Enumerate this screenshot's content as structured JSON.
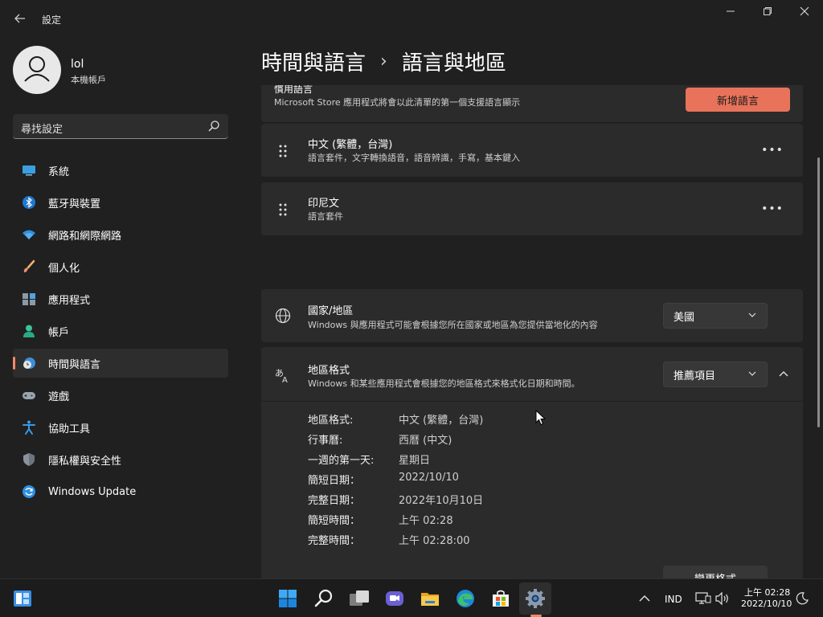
{
  "window": {
    "title": "設定",
    "controls": {
      "minimize": "—",
      "maximize": "❐",
      "close": "✕"
    }
  },
  "profile": {
    "name": "lol",
    "account_type": "本機帳戶"
  },
  "search": {
    "placeholder": "尋找設定"
  },
  "nav": [
    {
      "label": "系統",
      "icon": "system-icon"
    },
    {
      "label": "藍牙與裝置",
      "icon": "bluetooth-icon"
    },
    {
      "label": "網路和網際網路",
      "icon": "wifi-icon"
    },
    {
      "label": "個人化",
      "icon": "brush-icon"
    },
    {
      "label": "應用程式",
      "icon": "apps-icon"
    },
    {
      "label": "帳戶",
      "icon": "account-icon"
    },
    {
      "label": "時間與語言",
      "icon": "time-language-icon",
      "active": true
    },
    {
      "label": "遊戲",
      "icon": "gamepad-icon"
    },
    {
      "label": "協助工具",
      "icon": "accessibility-icon"
    },
    {
      "label": "隱私權與安全性",
      "icon": "shield-icon"
    },
    {
      "label": "Windows Update",
      "icon": "windows-update-icon"
    }
  ],
  "header": {
    "parent": "時間與語言",
    "separator": "›",
    "current": "語言與地區"
  },
  "preferred_languages": {
    "title": "慣用語言",
    "description": "Microsoft Store 應用程式將會以此清單的第一個支援語言顯示",
    "add_button": "新增語言",
    "languages": [
      {
        "name": "中文 (繁體，台灣)",
        "features": "語言套件，文字轉換語音，語音辨識，手寫，基本鍵入",
        "more": "•••"
      },
      {
        "name": "印尼文",
        "features": "語言套件",
        "more": "•••"
      }
    ]
  },
  "region": {
    "country": {
      "title": "國家/地區",
      "description": "Windows 與應用程式可能會根據您所在國家或地區為您提供當地化的內容",
      "value": "美國"
    },
    "regional_format": {
      "title": "地區格式",
      "description": "Windows 和某些應用程式會根據您的地區格式來格式化日期和時間。",
      "value": "推薦項目",
      "expanded": true,
      "details": [
        {
          "label": "地區格式:",
          "value": "中文 (繁體，台灣)"
        },
        {
          "label": "行事曆:",
          "value": "西曆 (中文)"
        },
        {
          "label": "一週的第一天:",
          "value": "星期日"
        },
        {
          "label": "簡短日期：",
          "value": "2022/10/10"
        },
        {
          "label": "完整日期：",
          "value": "2022年10月10日"
        },
        {
          "label": "簡短時間：",
          "value": "上午 02:28"
        },
        {
          "label": "完整時間：",
          "value": "上午 02:28:00"
        }
      ],
      "change_button": "變更格式"
    }
  },
  "taskbar": {
    "apps": [
      "start-icon",
      "search-icon",
      "task-view-icon",
      "chat-icon",
      "file-explorer-icon",
      "edge-icon",
      "store-icon",
      "settings-icon"
    ],
    "active_app": "settings-icon",
    "tray": {
      "input_indicator": "IND",
      "time": "上午 02:28",
      "date": "2022/10/10"
    }
  },
  "colors": {
    "background": "#202020",
    "card": "#2b2b2b",
    "accent": "#e8735a",
    "active_indicator": "#ef8a6a"
  }
}
